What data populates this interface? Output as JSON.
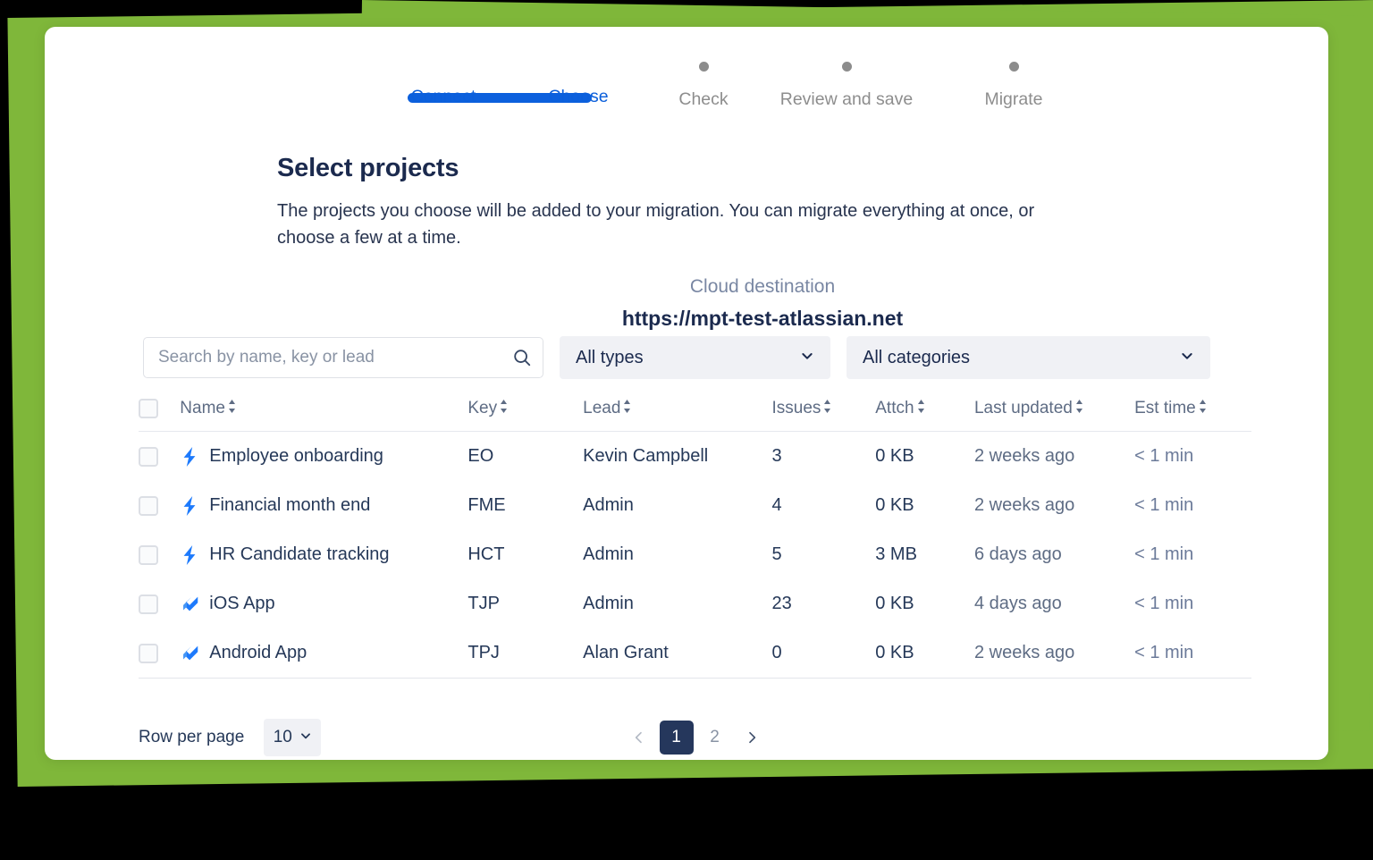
{
  "theme": {
    "accent_blue": "#0C60DD",
    "brand_green": "#7FB73A",
    "navy": "#1B2A4E",
    "muted": "#5E6C84",
    "pager_active_bg": "#25375C"
  },
  "stepper": {
    "steps": [
      {
        "label": "Connect",
        "state": "complete"
      },
      {
        "label": "Choose",
        "state": "active"
      },
      {
        "label": "Check",
        "state": "pending"
      },
      {
        "label": "Review and save",
        "state": "pending"
      },
      {
        "label": "Migrate",
        "state": "pending"
      }
    ]
  },
  "heading": {
    "title": "Select projects",
    "description": "The projects you choose will be added to your migration. You can migrate everything at once, or choose a few at a time."
  },
  "destination": {
    "label": "Cloud destination",
    "url": "https://mpt-test-atlassian.net"
  },
  "filters": {
    "search_placeholder": "Search by name, key or lead",
    "search_value": "",
    "search_icon": "search-icon",
    "type_filter": {
      "value": "All types",
      "chevron": "chevron-down-icon"
    },
    "category_filter": {
      "value": "All categories",
      "chevron": "chevron-down-icon"
    }
  },
  "table": {
    "columns": [
      {
        "key": "name",
        "label": "Name",
        "sortable": true
      },
      {
        "key": "key",
        "label": "Key",
        "sortable": true
      },
      {
        "key": "lead",
        "label": "Lead",
        "sortable": true
      },
      {
        "key": "issues",
        "label": "Issues",
        "sortable": true
      },
      {
        "key": "attch",
        "label": "Attch",
        "sortable": true
      },
      {
        "key": "last_updated",
        "label": "Last updated",
        "sortable": true
      },
      {
        "key": "est_time",
        "label": "Est time",
        "sortable": true
      }
    ],
    "select_all_checked": false,
    "rows": [
      {
        "checked": false,
        "icon": "jira-work-management-bolt-icon",
        "name": "Employee onboarding",
        "key": "EO",
        "lead": "Kevin Campbell",
        "issues": "3",
        "attch": "0 KB",
        "last_updated": "2 weeks ago",
        "est_time": "< 1 min"
      },
      {
        "checked": false,
        "icon": "jira-work-management-bolt-icon",
        "name": "Financial month end",
        "key": "FME",
        "lead": "Admin",
        "issues": "4",
        "attch": "0 KB",
        "last_updated": "2 weeks ago",
        "est_time": "< 1 min"
      },
      {
        "checked": false,
        "icon": "jira-work-management-bolt-icon",
        "name": "HR Candidate tracking",
        "key": "HCT",
        "lead": "Admin",
        "issues": "5",
        "attch": "3 MB",
        "last_updated": "6 days ago",
        "est_time": "< 1 min"
      },
      {
        "checked": false,
        "icon": "jira-software-icon",
        "name": "iOS App",
        "key": "TJP",
        "lead": "Admin",
        "issues": "23",
        "attch": "0 KB",
        "last_updated": "4 days ago",
        "est_time": "< 1 min"
      },
      {
        "checked": false,
        "icon": "jira-software-icon",
        "name": "Android App",
        "key": "TPJ",
        "lead": "Alan Grant",
        "issues": "0",
        "attch": "0 KB",
        "last_updated": "2 weeks ago",
        "est_time": "< 1 min"
      }
    ]
  },
  "footer": {
    "rows_per_page_label": "Row per page",
    "rows_per_page_value": "10",
    "pagination": {
      "prev_icon": "chevron-left-icon",
      "next_icon": "chevron-right-icon",
      "pages": [
        "1",
        "2"
      ],
      "current_page": "1"
    }
  }
}
